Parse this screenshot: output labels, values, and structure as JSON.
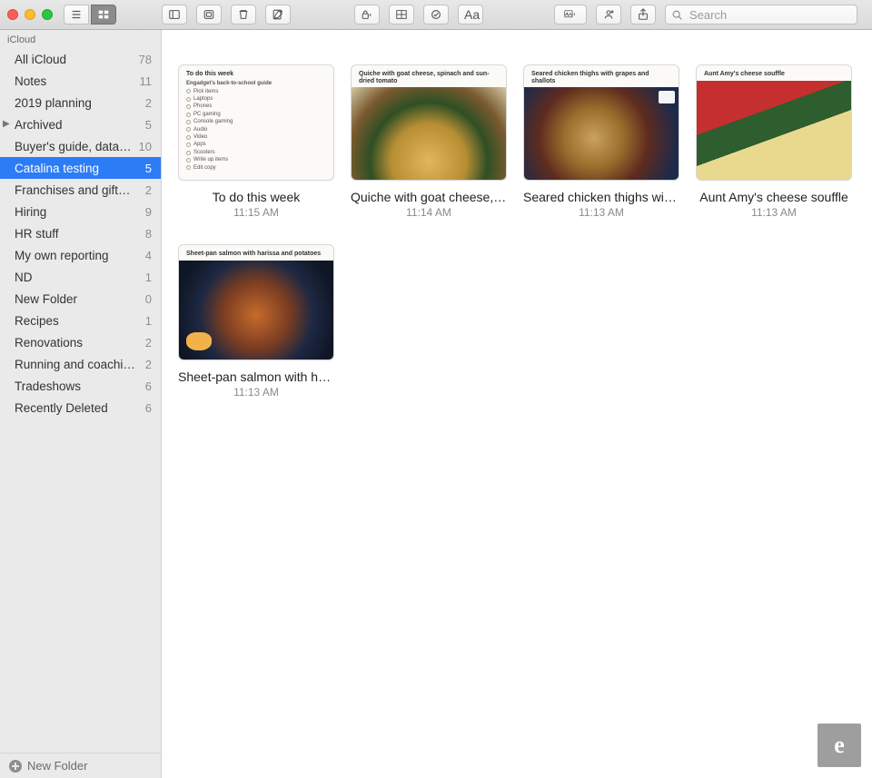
{
  "toolbar": {
    "search_placeholder": "Search",
    "view_list_icon": "list-icon",
    "view_gallery_icon": "gallery-icon",
    "sidebar_toggle_icon": "sidebar-icon",
    "attach_icon": "attachment-icon",
    "delete_icon": "trash-icon",
    "compose_icon": "compose-icon",
    "lock_icon": "lock-icon",
    "table_icon": "table-icon",
    "checklist_icon": "checklist-icon",
    "format_label": "Aa",
    "media_icon": "photos-icon",
    "collab_icon": "add-people-icon",
    "share_icon": "share-icon"
  },
  "sidebar": {
    "section": "iCloud",
    "rows": [
      {
        "label": "All iCloud",
        "count": "78",
        "indent": 0,
        "selected": false
      },
      {
        "label": "Notes",
        "count": "11",
        "indent": 0,
        "selected": false
      },
      {
        "label": "2019 planning",
        "count": "2",
        "indent": 0,
        "selected": false
      },
      {
        "label": "Archived",
        "count": "5",
        "indent": 0,
        "selected": false,
        "disclosure": true
      },
      {
        "label": "Buyer's guide, data…",
        "count": "10",
        "indent": 1,
        "selected": false
      },
      {
        "label": "Catalina testing",
        "count": "5",
        "indent": 1,
        "selected": true
      },
      {
        "label": "Franchises and gift…",
        "count": "2",
        "indent": 1,
        "selected": false
      },
      {
        "label": "Hiring",
        "count": "9",
        "indent": 1,
        "selected": false
      },
      {
        "label": "HR stuff",
        "count": "8",
        "indent": 1,
        "selected": false
      },
      {
        "label": "My own reporting",
        "count": "4",
        "indent": 1,
        "selected": false
      },
      {
        "label": "ND",
        "count": "1",
        "indent": 1,
        "selected": false
      },
      {
        "label": "New Folder",
        "count": "0",
        "indent": 1,
        "selected": false
      },
      {
        "label": "Recipes",
        "count": "1",
        "indent": 1,
        "selected": false
      },
      {
        "label": "Renovations",
        "count": "2",
        "indent": 1,
        "selected": false
      },
      {
        "label": "Running and coachi…",
        "count": "2",
        "indent": 1,
        "selected": false
      },
      {
        "label": "Tradeshows",
        "count": "6",
        "indent": 1,
        "selected": false
      },
      {
        "label": "Recently Deleted",
        "count": "6",
        "indent": 1,
        "selected": false
      }
    ],
    "new_folder_label": "New Folder"
  },
  "notes": [
    {
      "title": "To do this week",
      "time": "11:15 AM",
      "kind": "todo",
      "inside_title": "To do this week",
      "inside_subhead": "Engadget's back-to-school guide",
      "items": [
        "Pick items",
        "Laptops",
        "Phones",
        "PC gaming",
        "Console gaming",
        "Audio",
        "Video",
        "Apps",
        "Scooters",
        "Write up items",
        "Edit copy"
      ]
    },
    {
      "title": "Quiche with goat cheese, s…",
      "time": "11:14 AM",
      "kind": "photo",
      "inside_title": "Quiche with goat cheese, spinach and sun-dried tomato",
      "photo_class": "foto-quiche"
    },
    {
      "title": "Seared chicken thighs with…",
      "time": "11:13 AM",
      "kind": "photo",
      "inside_title": "Seared chicken thighs with grapes and shallots",
      "photo_class": "foto-chicken"
    },
    {
      "title": "Aunt Amy's cheese souffle",
      "time": "11:13 AM",
      "kind": "photo",
      "inside_title": "Aunt Amy's cheese souffle",
      "photo_class": "foto-souffle"
    },
    {
      "title": "Sheet-pan salmon with har…",
      "time": "11:13 AM",
      "kind": "photo",
      "inside_title": "Sheet-pan salmon with harissa and potatoes",
      "photo_class": "foto-salmon"
    }
  ],
  "corner_badge": "e"
}
